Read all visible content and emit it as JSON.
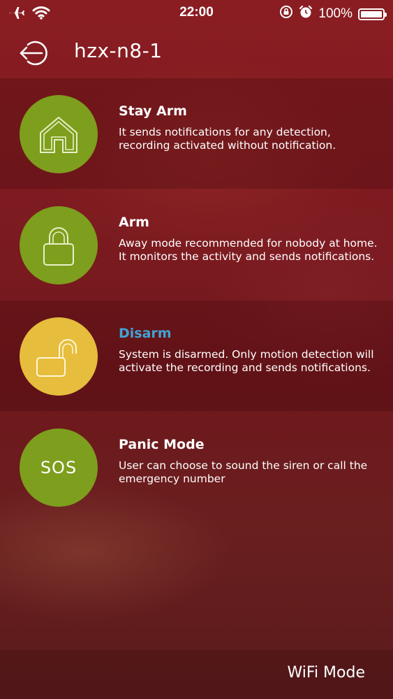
{
  "status_bar": {
    "time": "22:00",
    "battery_text": "100%",
    "icons": [
      "airplane-icon",
      "wifi-icon",
      "orientation-lock-icon",
      "alarm-icon",
      "battery-icon"
    ]
  },
  "header": {
    "title": "hzx-n8-1",
    "back_icon": "logout-arrow-icon"
  },
  "modes": [
    {
      "title": "Stay Arm",
      "description": "It sends notifications for any detection, recording activated without notification.",
      "icon": "home-icon",
      "circle_color": "#7e9e1d",
      "active": false
    },
    {
      "title": "Arm",
      "description": "Away mode recommended for nobody at home. It monitors the activity and sends notifications.",
      "icon": "lock-closed-icon",
      "circle_color": "#7e9e1d",
      "active": false
    },
    {
      "title": "Disarm",
      "description": "System is disarmed. Only motion detection will activate the recording and sends notifications.",
      "icon": "lock-open-icon",
      "circle_color": "#e6bd3c",
      "active": true
    },
    {
      "title": "Panic Mode",
      "description": "User can choose to sound the siren or call the emergency number",
      "icon": "sos-icon",
      "icon_text": "SOS",
      "circle_color": "#7e9e1d",
      "active": false
    }
  ],
  "colors": {
    "active_title": "#3fa3d6",
    "title": "#ffffff"
  },
  "footer": {
    "wifi_mode_label": "WiFi Mode"
  }
}
